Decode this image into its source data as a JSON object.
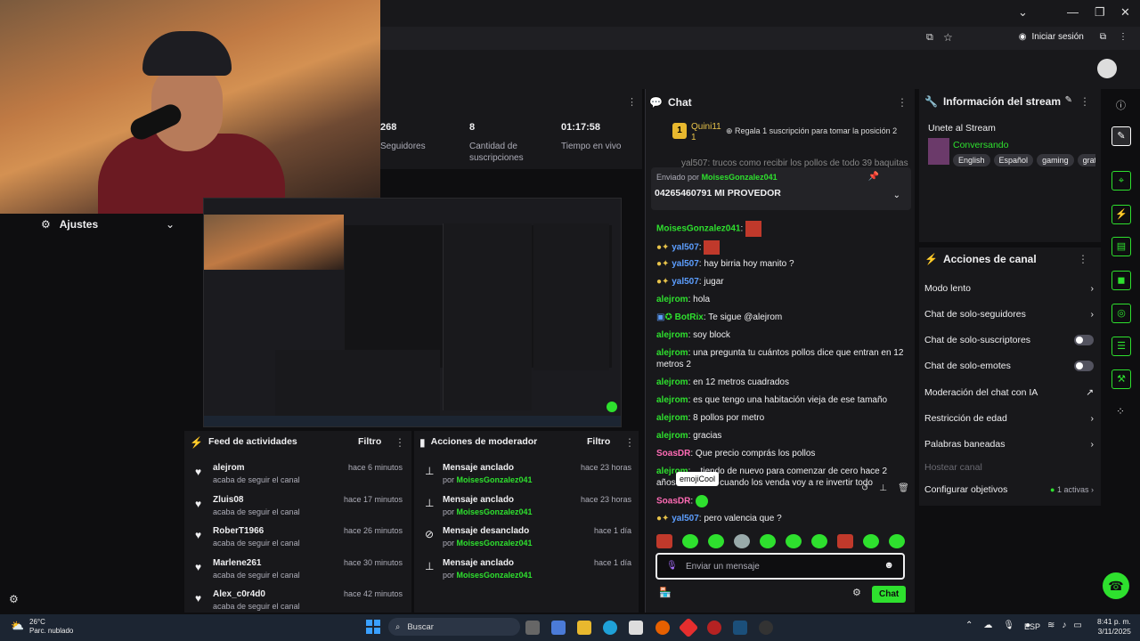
{
  "browser": {
    "signin": "Iniciar sesión"
  },
  "stats": [
    {
      "value": "268",
      "label": "Seguidores"
    },
    {
      "value": "8",
      "label": "Cantidad de suscripciones"
    },
    {
      "value": "01:17:58",
      "label": "Tiempo en vivo"
    }
  ],
  "settings": {
    "label": "Ajustes"
  },
  "chat": {
    "title": "Chat",
    "top_user": "Quini11",
    "top_rank": "1",
    "gift_text": "Regala 1 suscripción para tomar la posición 2",
    "pinned_by": "Enviado por",
    "pinned_user": "MoisesGonzalez041",
    "pinned_msg": "04265460791 MI PROVEDOR",
    "top_cut": "yal507: trucos como recibir los pollos de todo 39 baquitas",
    "messages": [
      {
        "user": "MoisesGonzalez041",
        "text": ""
      },
      {
        "user": "yal507",
        "text": ""
      },
      {
        "user": "yal507",
        "text": "hay birria hoy manito ?"
      },
      {
        "user": "yal507",
        "text": "jugar"
      },
      {
        "user": "alejrom",
        "text": "hola"
      },
      {
        "user": "BotRix",
        "text": "Te sigue @alejrom"
      },
      {
        "user": "alejrom",
        "text": "soy block"
      },
      {
        "user": "alejrom",
        "text": "una pregunta tu cuántos pollos dice que entran en 12 metros 2"
      },
      {
        "user": "alejrom",
        "text": "en 12 metros cuadrados"
      },
      {
        "user": "alejrom",
        "text": "es que tengo una habitación vieja de ese tamaño"
      },
      {
        "user": "alejrom",
        "text": "8 pollos por metro"
      },
      {
        "user": "alejrom",
        "text": "gracias"
      },
      {
        "user": "SoasDR",
        "text": "Que precio comprás los pollos"
      },
      {
        "user": "alejrom",
        "text": "...tiendo de nuevo para comenzar de cero hace 2 años ... meti 30 cuando los venda voy a re invertir todo"
      },
      {
        "user": "SoasDR",
        "text": ""
      },
      {
        "user": "yal507",
        "text": "pero valencia que ?"
      }
    ],
    "tooltip": "emojiCool",
    "input_placeholder": "Enviar un mensaje",
    "send_label": "Chat"
  },
  "info": {
    "title": "Información del stream",
    "stream_title": "Unete al Stream",
    "category": "Conversando",
    "tags": [
      "English",
      "Español",
      "gaming",
      "grat"
    ]
  },
  "actions": {
    "title": "Acciones de canal",
    "items": [
      {
        "label": "Modo lento",
        "ctrl": "chevron"
      },
      {
        "label": "Chat de solo-seguidores",
        "ctrl": "chevron"
      },
      {
        "label": "Chat de solo-suscriptores",
        "ctrl": "toggle"
      },
      {
        "label": "Chat de solo-emotes",
        "ctrl": "toggle"
      },
      {
        "label": "Moderación del chat con IA",
        "ctrl": "external"
      },
      {
        "label": "Restricción de edad",
        "ctrl": "chevron"
      },
      {
        "label": "Palabras baneadas",
        "ctrl": "chevron"
      },
      {
        "label": "Hostear canal",
        "ctrl": "none"
      },
      {
        "label": "Configurar objetivos",
        "ctrl": "chevron",
        "extra": "1 activas"
      }
    ]
  },
  "feed": {
    "title": "Feed de actividades",
    "filter": "Filtro",
    "items": [
      {
        "user": "alejrom",
        "time": "hace 6 minutos",
        "sub": "acaba de seguir el canal"
      },
      {
        "user": "Zluis08",
        "time": "hace 17 minutos",
        "sub": "acaba de seguir el canal"
      },
      {
        "user": "RoberT1966",
        "time": "hace 26 minutos",
        "sub": "acaba de seguir el canal"
      },
      {
        "user": "Marlene261",
        "time": "hace 30 minutos",
        "sub": "acaba de seguir el canal"
      },
      {
        "user": "Alex_c0r4d0",
        "time": "hace 42 minutos",
        "sub": "acaba de seguir el canal"
      }
    ]
  },
  "mod": {
    "title": "Acciones de moderador",
    "filter": "Filtro",
    "items": [
      {
        "action": "Mensaje anclado",
        "by": "por",
        "user": "MoisesGonzalez041",
        "time": "hace 23 horas"
      },
      {
        "action": "Mensaje anclado",
        "by": "por",
        "user": "MoisesGonzalez041",
        "time": "hace 23 horas"
      },
      {
        "action": "Mensaje desanclado",
        "by": "por",
        "user": "MoisesGonzalez041",
        "time": "hace 1 día"
      },
      {
        "action": "Mensaje anclado",
        "by": "por",
        "user": "MoisesGonzalez041",
        "time": "hace 1 día"
      }
    ]
  },
  "taskbar": {
    "weather_temp": "26°C",
    "weather_desc": "Parc. nublado",
    "search": "Buscar",
    "lang": "ESP",
    "time": "8:41 p. m.",
    "date": "3/11/2025"
  }
}
